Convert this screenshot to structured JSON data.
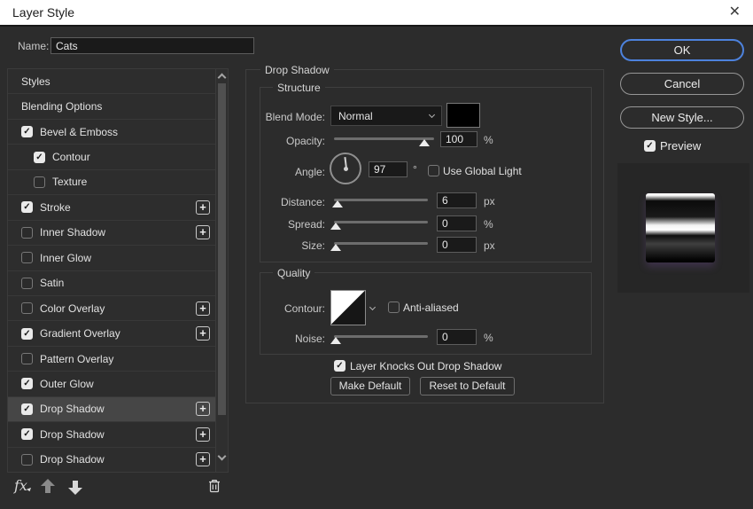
{
  "window": {
    "title": "Layer Style",
    "close_glyph": "✕"
  },
  "name_field": {
    "label": "Name:",
    "value": "Cats"
  },
  "sidebar": {
    "items": [
      {
        "label": "Styles",
        "checkable": false,
        "plus": false
      },
      {
        "label": "Blending Options",
        "checkable": false,
        "plus": false
      },
      {
        "label": "Bevel & Emboss",
        "checkable": true,
        "checked": true,
        "plus": false
      },
      {
        "label": "Contour",
        "checkable": true,
        "checked": true,
        "plus": false,
        "indented": true
      },
      {
        "label": "Texture",
        "checkable": true,
        "checked": false,
        "plus": false,
        "indented": true
      },
      {
        "label": "Stroke",
        "checkable": true,
        "checked": true,
        "plus": true
      },
      {
        "label": "Inner Shadow",
        "checkable": true,
        "checked": false,
        "plus": true
      },
      {
        "label": "Inner Glow",
        "checkable": true,
        "checked": false,
        "plus": false
      },
      {
        "label": "Satin",
        "checkable": true,
        "checked": false,
        "plus": false
      },
      {
        "label": "Color Overlay",
        "checkable": true,
        "checked": false,
        "plus": true
      },
      {
        "label": "Gradient Overlay",
        "checkable": true,
        "checked": true,
        "plus": true
      },
      {
        "label": "Pattern Overlay",
        "checkable": true,
        "checked": false,
        "plus": false
      },
      {
        "label": "Outer Glow",
        "checkable": true,
        "checked": true,
        "plus": false
      },
      {
        "label": "Drop Shadow",
        "checkable": true,
        "checked": true,
        "plus": true,
        "selected": true
      },
      {
        "label": "Drop Shadow",
        "checkable": true,
        "checked": true,
        "plus": true
      },
      {
        "label": "Drop Shadow",
        "checkable": true,
        "checked": false,
        "plus": true
      }
    ],
    "footer": {
      "fx_label": "fx"
    }
  },
  "panel": {
    "title": "Drop Shadow",
    "structure": {
      "title": "Structure",
      "blend_mode": {
        "label": "Blend Mode:",
        "value": "Normal",
        "swatch_color": "#000000"
      },
      "opacity": {
        "label": "Opacity:",
        "value": "100",
        "unit": "%",
        "pos": 90
      },
      "angle": {
        "label": "Angle:",
        "value": "97",
        "unit": "°",
        "use_global_light": {
          "label": "Use Global Light",
          "checked": false
        }
      },
      "distance": {
        "label": "Distance:",
        "value": "6",
        "unit": "px",
        "pos": 4
      },
      "spread": {
        "label": "Spread:",
        "value": "0",
        "unit": "%",
        "pos": 2
      },
      "size": {
        "label": "Size:",
        "value": "0",
        "unit": "px",
        "pos": 2
      }
    },
    "quality": {
      "title": "Quality",
      "contour": {
        "label": "Contour:",
        "anti_aliased": {
          "label": "Anti-aliased",
          "checked": false
        }
      },
      "noise": {
        "label": "Noise:",
        "value": "0",
        "unit": "%",
        "pos": 2
      }
    },
    "knockout": {
      "label": "Layer Knocks Out Drop Shadow",
      "checked": true
    },
    "buttons": {
      "make_default": "Make Default",
      "reset_to_default": "Reset to Default"
    }
  },
  "actions": {
    "ok": "OK",
    "cancel": "Cancel",
    "new_style": "New Style...",
    "preview": {
      "label": "Preview",
      "checked": true
    }
  },
  "colors": {
    "accent_blue": "#4d82dd",
    "shadow_swatch": "#000000"
  }
}
